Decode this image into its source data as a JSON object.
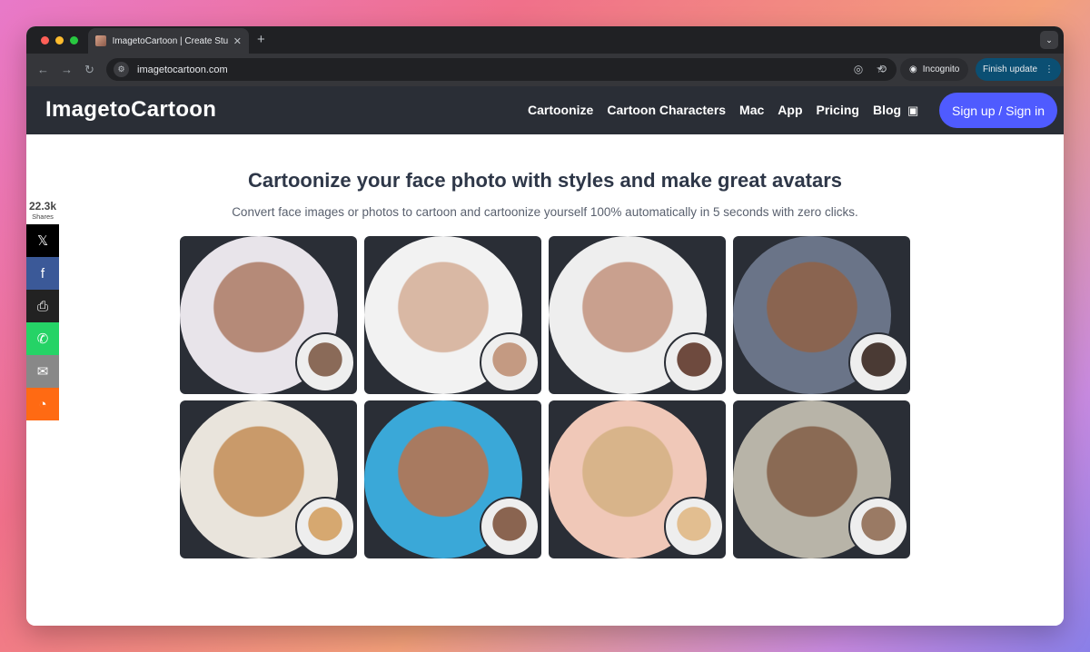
{
  "browser": {
    "tab_title": "ImagetoCartoon | Create Stun",
    "tab_close": "✕",
    "new_tab": "+",
    "url": "imagetocartoon.com",
    "incognito_label": "Incognito",
    "finish_update_label": "Finish update"
  },
  "site": {
    "logo": "ImagetoCartoon",
    "nav": [
      "Cartoonize",
      "Cartoon Characters",
      "Mac",
      "App",
      "Pricing",
      "Blog"
    ],
    "signin_label": "Sign up / Sign in"
  },
  "hero": {
    "title": "Cartoonize your face photo with styles and make great avatars",
    "subtitle": "Convert face images or photos to cartoon and cartoonize yourself 100% automatically in 5 seconds with zero clicks."
  },
  "share": {
    "count": "22.3k",
    "label": "Shares",
    "buttons": [
      {
        "name": "x",
        "icon": "x-icon",
        "glyph": "𝕏",
        "color": "#000000"
      },
      {
        "name": "facebook",
        "icon": "facebook-icon",
        "glyph": "f",
        "color": "#3b5998"
      },
      {
        "name": "print",
        "icon": "print-icon",
        "glyph": "⎙",
        "color": "#222222"
      },
      {
        "name": "whatsapp",
        "icon": "whatsapp-icon",
        "glyph": "✆",
        "color": "#25d366"
      },
      {
        "name": "email",
        "icon": "email-icon",
        "glyph": "✉",
        "color": "#888888"
      },
      {
        "name": "sumo",
        "icon": "sumo-icon",
        "glyph": "◔",
        "color": "#ff6a13"
      }
    ]
  },
  "gallery": [
    {
      "big": "#b58a78",
      "bg": "#e8e4ea",
      "small": "#8a6a58"
    },
    {
      "big": "#d9b8a4",
      "bg": "#f2f2f2",
      "small": "#c49a82"
    },
    {
      "big": "#c9a08e",
      "bg": "#eeeeee",
      "small": "#6e4a3e"
    },
    {
      "big": "#8a6450",
      "bg": "#6a7488",
      "small": "#4a3a34"
    },
    {
      "big": "#c99a6a",
      "bg": "#e9e4dc",
      "small": "#d6a870"
    },
    {
      "big": "#a87a60",
      "bg": "#3aa8d8",
      "small": "#8a6450"
    },
    {
      "big": "#d8b48a",
      "bg": "#f0c8b8",
      "small": "#e2be90"
    },
    {
      "big": "#8a6a54",
      "bg": "#b8b4a8",
      "small": "#9a7a64"
    }
  ]
}
